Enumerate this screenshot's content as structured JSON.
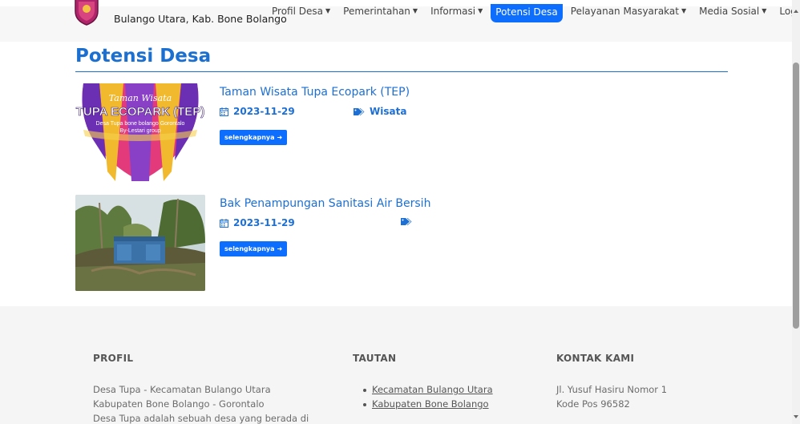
{
  "brand": {
    "text": "Bulango Utara, Kab. Bone Bolango"
  },
  "nav": {
    "items": [
      {
        "label": "Profil Desa",
        "dropdown": true
      },
      {
        "label": "Pemerintahan",
        "dropdown": true
      },
      {
        "label": "Informasi",
        "dropdown": true
      },
      {
        "label": "Potensi Desa",
        "dropdown": false,
        "active": true
      },
      {
        "label": "Pelayanan Masyarakat",
        "dropdown": true
      },
      {
        "label": "Media Sosial",
        "dropdown": true
      },
      {
        "label": "Login",
        "dropdown": false
      }
    ]
  },
  "page": {
    "title": "Potensi Desa"
  },
  "items": [
    {
      "title": "Taman Wisata Tupa Ecopark (TEP)",
      "date": "2023-11-29",
      "category": "Wisata",
      "button": "selengkapnya",
      "thumb": {
        "script_line": "Taman Wisata",
        "headline": "TUPA ECOPARK (TEP)",
        "sub1": "Desa Tupa bone bolango Gorontalo",
        "sub2": "By-Lestari group"
      }
    },
    {
      "title": "Bak Penampungan Sanitasi Air Bersih",
      "date": "2023-11-29",
      "category": "",
      "button": "selengkapnya"
    }
  ],
  "footer": {
    "profil": {
      "heading": "PROFIL",
      "lines": [
        "Desa Tupa - Kecamatan Bulango Utara",
        "Kabupaten Bone Bolango - Gorontalo",
        "Desa Tupa adalah sebuah desa yang berada di"
      ]
    },
    "tautan": {
      "heading": "TAUTAN",
      "links": [
        "Kecamatan Bulango Utara",
        "Kabupaten Bone Bolango"
      ]
    },
    "kontak": {
      "heading": "KONTAK KAMI",
      "lines": [
        "Jl. Yusuf Hasiru Nomor 1",
        "Kode Pos 96582"
      ]
    }
  },
  "colors": {
    "primary": "#0d6efd",
    "link": "#1d6fd4",
    "footer_bg": "#f5f5f5"
  },
  "icons": [
    "calendar-icon",
    "tag-icon",
    "arrow-right-icon",
    "caret-down-icon",
    "village-logo-icon"
  ]
}
